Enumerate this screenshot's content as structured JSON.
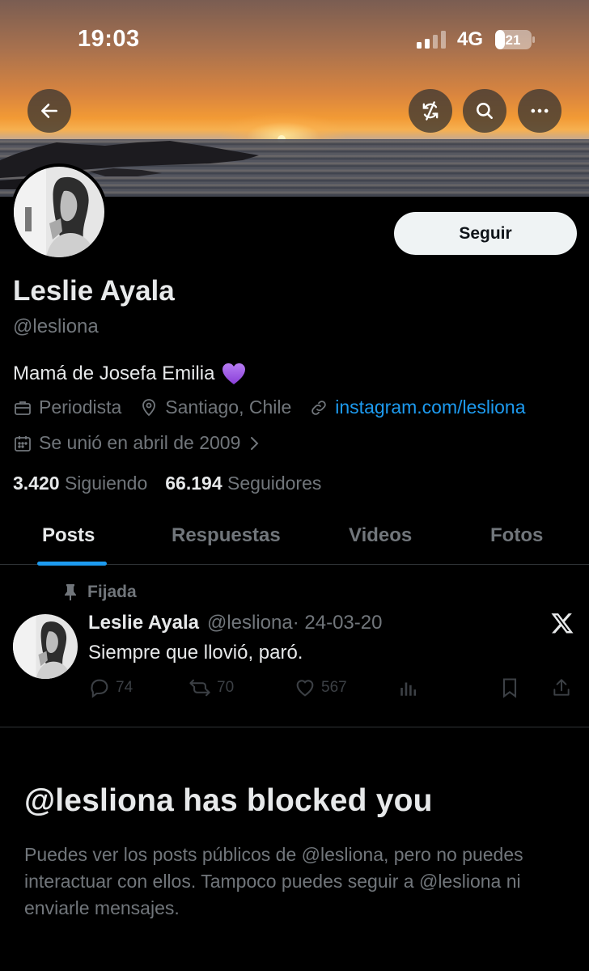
{
  "status_bar": {
    "time": "19:03",
    "network": "4G",
    "battery": "21"
  },
  "banner": {
    "back_icon": "arrow-left-icon",
    "actions": [
      "sync-off-icon",
      "search-icon",
      "more-icon"
    ]
  },
  "profile": {
    "follow_label": "Seguir",
    "name": "Leslie Ayala",
    "handle": "@lesliona",
    "bio": "Mamá de Josefa Emilia",
    "bio_emoji": "💜",
    "profession": "Periodista",
    "location": "Santiago, Chile",
    "link": "instagram.com/lesliona",
    "joined": "Se unió en abril de 2009",
    "following_count": "3.420",
    "following_label": "Siguiendo",
    "followers_count": "66.194",
    "followers_label": "Seguidores"
  },
  "tabs": [
    {
      "label": "Posts",
      "active": true
    },
    {
      "label": "Respuestas",
      "active": false
    },
    {
      "label": "Videos",
      "active": false
    },
    {
      "label": "Fotos",
      "active": false
    }
  ],
  "pinned_post": {
    "pinned_label": "Fijada",
    "author": "Leslie Ayala",
    "handle": "@lesliona",
    "date": "· 24-03-20",
    "text": "Siempre que llovió, paró.",
    "replies": "74",
    "reposts": "70",
    "likes": "567"
  },
  "blocked": {
    "title": "@lesliona has blocked you",
    "message": "Puedes ver los posts públicos de @lesliona, pero no puedes interactuar con ellos. Tampoco puedes seguir a @lesliona ni enviarle mensajes."
  },
  "colors": {
    "accent": "#1d9bf0",
    "text": "#e7e9ea",
    "muted": "#71767b",
    "background": "#000000"
  }
}
